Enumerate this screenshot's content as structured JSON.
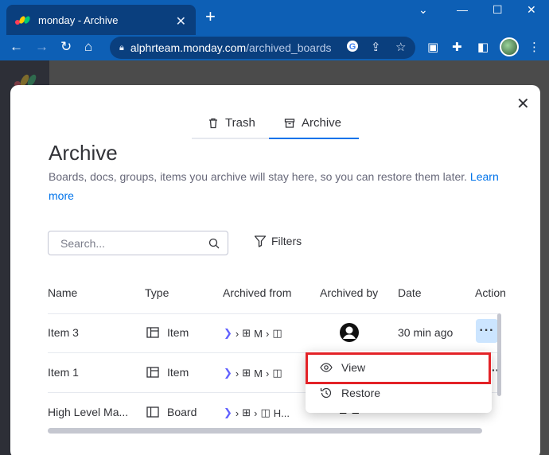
{
  "browser": {
    "tab_title": "monday - Archive",
    "url_host": "alphrteam.monday.com",
    "url_path": "/archived_boards"
  },
  "modal": {
    "tabs": [
      {
        "label": "Trash",
        "icon": "trash-icon"
      },
      {
        "label": "Archive",
        "icon": "archive-icon",
        "active": true
      }
    ],
    "title": "Archive",
    "description": "Boards, docs, groups, items you archive will stay here, so you can restore them later.",
    "learn_more": "Learn more",
    "search_placeholder": "Search...",
    "filters_label": "Filters",
    "columns": [
      "Name",
      "Type",
      "Archived from",
      "Archived by",
      "Date",
      "Action"
    ],
    "rows": [
      {
        "name": "Item 3",
        "type": "Item",
        "from_a": "M",
        "from_b": "",
        "date": "30 min ago"
      },
      {
        "name": "Item 1",
        "type": "Item",
        "from_a": "M",
        "from_b": "",
        "date": ""
      },
      {
        "name": "High Level Ma...",
        "type": "Board",
        "from_a": "",
        "from_b": "H...",
        "date": ""
      }
    ],
    "context_menu": {
      "view": "View",
      "restore": "Restore"
    }
  },
  "colors": {
    "chrome_blue": "#0d5fb5",
    "accent": "#0073ea",
    "highlight_red": "#e32227"
  }
}
